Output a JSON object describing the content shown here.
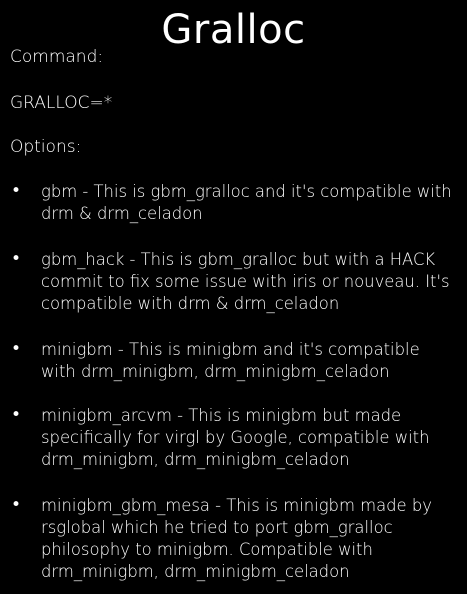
{
  "title": "Gralloc",
  "command_label": "Command:",
  "command_value": "GRALLOC=*",
  "options_label": "Options:",
  "bullet_glyph": "•",
  "options": [
    "gbm - This is gbm_gralloc and it's compatible with drm & drm_celadon",
    "gbm_hack - This is gbm_gralloc but with a HACK commit to fix some issue with iris or nouveau. It's compatible with drm & drm_celadon",
    "minigbm - This is minigbm and it's compatible with drm_minigbm, drm_minigbm_celadon",
    "minigbm_arcvm - This is minigbm but made specifically for virgl by Google, compatible with drm_minigbm, drm_minigbm_celadon",
    "minigbm_gbm_mesa - This is minigbm made by rsglobal which he tried to port gbm_gralloc philosophy to minigbm. Compatible with drm_minigbm, drm_minigbm_celadon"
  ]
}
